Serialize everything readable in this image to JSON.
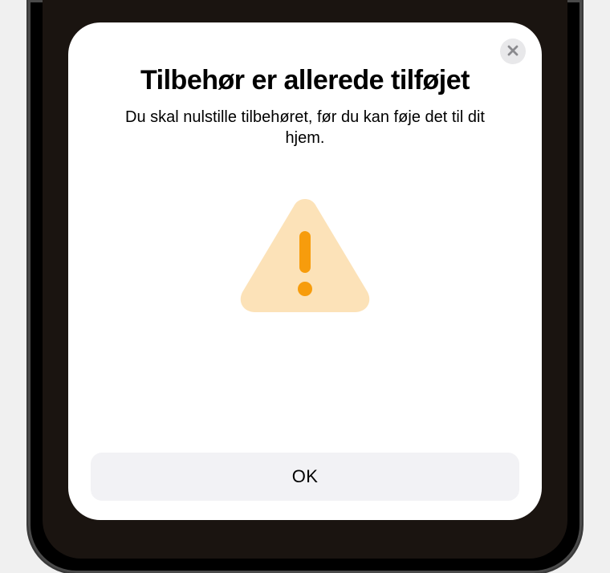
{
  "dialog": {
    "title": "Tilbehør er allerede tilføjet",
    "subtitle": "Du skal nulstille tilbehøret, før du kan føje det til dit hjem.",
    "ok_label": "OK"
  },
  "icons": {
    "close": "close-icon",
    "warning": "warning-triangle-icon"
  },
  "colors": {
    "warning_fill": "#FCE2B8",
    "warning_symbol": "#F79C0C",
    "button_bg": "#f2f2f5",
    "close_bg": "#e8e8ea"
  }
}
